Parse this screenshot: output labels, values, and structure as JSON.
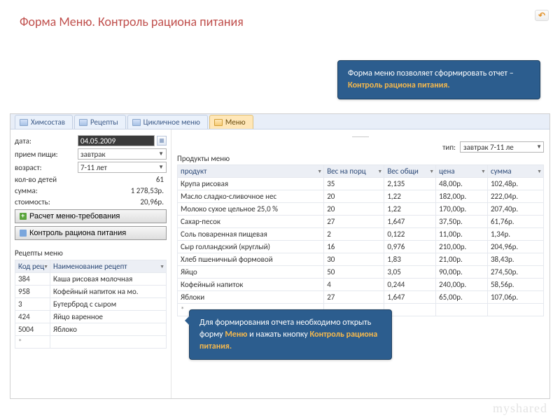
{
  "page": {
    "title": "Форма Меню. Контроль рациона питания"
  },
  "back_icon": "↶",
  "callout_top": {
    "line1": "Форма меню позволяет сформировать отчет – ",
    "accent": "Контроль рациона питания."
  },
  "callout_bottom": {
    "line1": "Для формирования отчета необходимо открыть форму ",
    "accent1": "Меню",
    "line2": " и нажать кнопку ",
    "accent2": "Контроль рациона питания."
  },
  "tabs": [
    {
      "label": "Химсостав",
      "active": false
    },
    {
      "label": "Рецепты",
      "active": false
    },
    {
      "label": "Цикличное меню",
      "active": false
    },
    {
      "label": "Меню",
      "active": true
    }
  ],
  "form": {
    "date_label": "дата:",
    "date_value": "04.05.2009",
    "meal_label": "прием пищи:",
    "meal_value": "завтрак",
    "age_label": "возраст:",
    "age_value": "7-11 лет",
    "children_label": "кол-во детей",
    "children_value": "61",
    "sum_label": "сумма:",
    "sum_value": "1 278,53р.",
    "cost_label": "стоимость:",
    "cost_value": "20,96р."
  },
  "buttons": {
    "calc": "Расчет меню-требования",
    "control": "Контроль рациона питания"
  },
  "recipes": {
    "heading": "Рецепты меню",
    "cols": [
      "Код рец",
      "Наименование рецепт"
    ],
    "rows": [
      [
        "384",
        "Каша рисовая молочная"
      ],
      [
        "958",
        "Кофейный напиток на мо."
      ],
      [
        "3",
        "Бутерброд с сыром"
      ],
      [
        "424",
        "Яйцо варенное"
      ],
      [
        "5004",
        "Яблоко"
      ]
    ]
  },
  "products": {
    "heading": "Продукты меню",
    "type_label": "тип:",
    "type_value": "завтрак 7-11 ле",
    "cols": [
      "продукт",
      "Вес на порц",
      "Вес общи",
      "цена",
      "сумма"
    ],
    "rows": [
      [
        "Крупа рисовая",
        "35",
        "2,135",
        "48,00р.",
        "102,48р."
      ],
      [
        "Масло сладко-сливочное нес",
        "20",
        "1,22",
        "182,00р.",
        "222,04р."
      ],
      [
        "Молоко сухое цельное 25,0 %",
        "20",
        "1,22",
        "170,00р.",
        "207,40р."
      ],
      [
        "Сахар-песок",
        "27",
        "1,647",
        "37,50р.",
        "61,76р."
      ],
      [
        "Соль поваренная пищевая",
        "2",
        "0,122",
        "11,00р.",
        "1,34р."
      ],
      [
        "Сыр голландский (круглый)",
        "16",
        "0,976",
        "210,00р.",
        "204,96р."
      ],
      [
        "Хлеб пшеничный формовой",
        "30",
        "1,83",
        "21,00р.",
        "38,43р."
      ],
      [
        "Яйцо",
        "50",
        "3,05",
        "90,00р.",
        "274,50р."
      ],
      [
        "Кофейный напиток",
        "4",
        "0,244",
        "240,00р.",
        "58,56р."
      ],
      [
        "Яблоки",
        "27",
        "1,647",
        "65,00р.",
        "107,06р."
      ]
    ]
  },
  "watermark": "myshared"
}
